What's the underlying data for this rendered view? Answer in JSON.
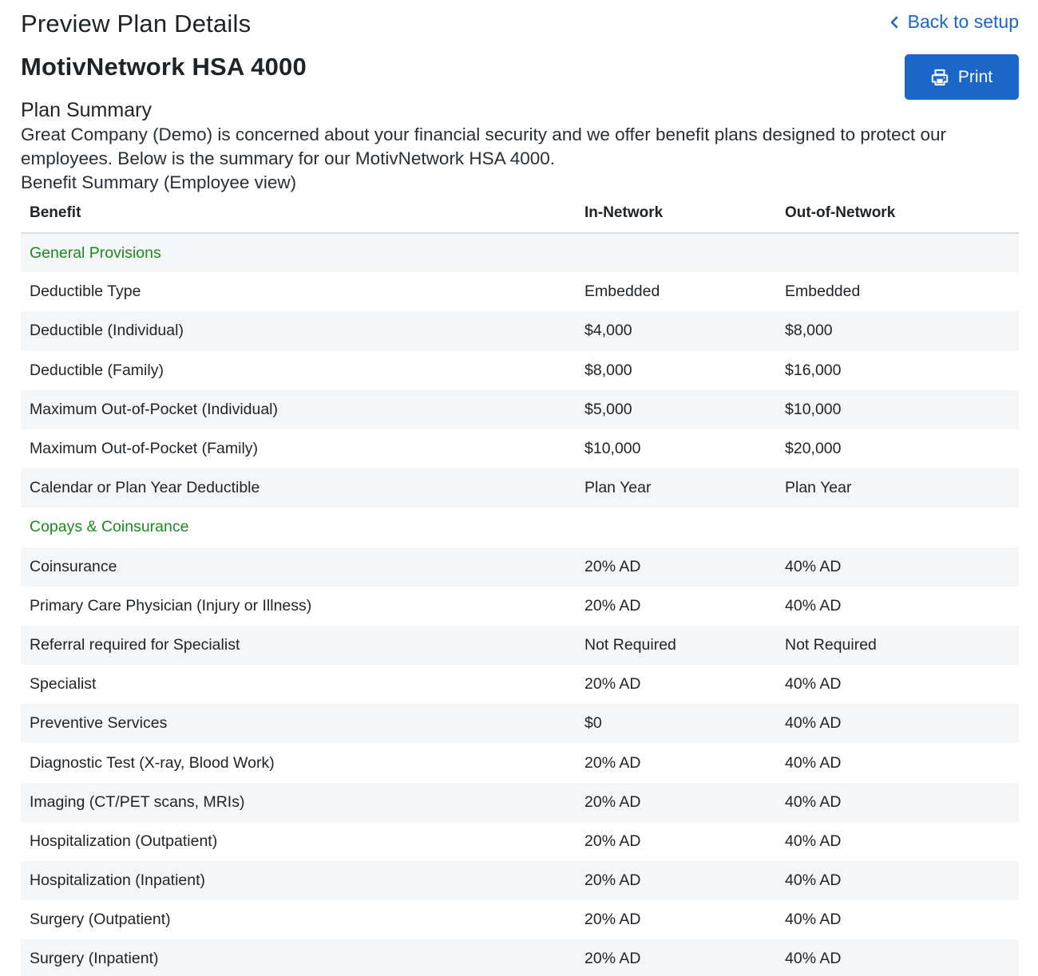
{
  "header": {
    "title": "Preview Plan Details",
    "back_label": "Back to setup",
    "print_label": "Print"
  },
  "plan": {
    "name": "MotivNetwork HSA 4000",
    "summary_heading": "Plan Summary",
    "summary_text": "Great Company (Demo) is concerned about your financial security and we offer benefit plans designed to protect our employees.  Below is the summary for our MotivNetwork HSA 4000.",
    "benefit_summary_label": "Benefit Summary (Employee view)"
  },
  "table": {
    "columns": [
      "Benefit",
      "In-Network",
      "Out-of-Network"
    ],
    "rows": [
      {
        "section": "General Provisions"
      },
      {
        "benefit": "Deductible Type",
        "in": "Embedded",
        "out": "Embedded"
      },
      {
        "benefit": "Deductible (Individual)",
        "in": "$4,000",
        "out": "$8,000"
      },
      {
        "benefit": "Deductible (Family)",
        "in": "$8,000",
        "out": "$16,000"
      },
      {
        "benefit": "Maximum Out-of-Pocket (Individual)",
        "in": "$5,000",
        "out": "$10,000"
      },
      {
        "benefit": "Maximum Out-of-Pocket (Family)",
        "in": "$10,000",
        "out": "$20,000"
      },
      {
        "benefit": "Calendar or Plan Year Deductible",
        "in": "Plan Year",
        "out": "Plan Year"
      },
      {
        "section": "Copays & Coinsurance"
      },
      {
        "benefit": "Coinsurance",
        "in": "20% AD",
        "out": "40% AD"
      },
      {
        "benefit": "Primary Care Physician (Injury or Illness)",
        "in": "20% AD",
        "out": "40% AD"
      },
      {
        "benefit": "Referral required for Specialist",
        "in": "Not Required",
        "out": "Not Required"
      },
      {
        "benefit": "Specialist",
        "in": "20% AD",
        "out": "40% AD"
      },
      {
        "benefit": "Preventive Services",
        "in": "$0",
        "out": "40% AD"
      },
      {
        "benefit": "Diagnostic Test (X-ray, Blood Work)",
        "in": "20% AD",
        "out": "40% AD"
      },
      {
        "benefit": "Imaging (CT/PET scans, MRIs)",
        "in": "20% AD",
        "out": "40% AD"
      },
      {
        "benefit": "Hospitalization (Outpatient)",
        "in": "20% AD",
        "out": "40% AD"
      },
      {
        "benefit": "Hospitalization (Inpatient)",
        "in": "20% AD",
        "out": "40% AD"
      },
      {
        "benefit": "Surgery (Outpatient)",
        "in": "20% AD",
        "out": "40% AD"
      },
      {
        "benefit": "Surgery (Inpatient)",
        "in": "20% AD",
        "out": "40% AD"
      }
    ]
  },
  "colors": {
    "accent": "#1b66c9",
    "section_text": "#1c8a1c",
    "stripe": "#f5f6f8"
  },
  "icons": {
    "back": "chevron-left-icon",
    "print": "printer-icon"
  }
}
